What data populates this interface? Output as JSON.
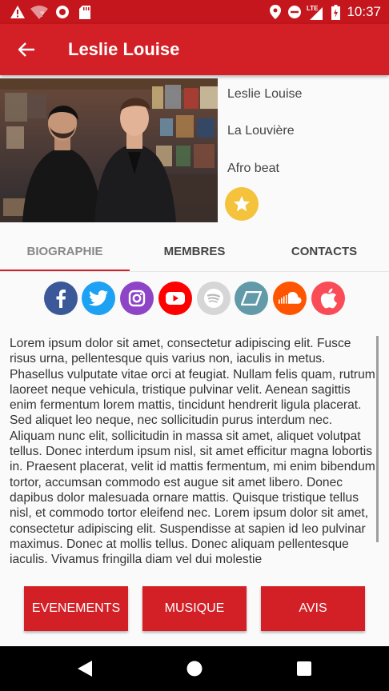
{
  "status_bar": {
    "time": "10:37",
    "network": "LTE"
  },
  "app_bar": {
    "title": "Leslie Louise"
  },
  "artist": {
    "name": "Leslie Louise",
    "city": "La Louvière",
    "genre": "Afro beat"
  },
  "tabs": [
    {
      "label": "BIOGRAPHIE",
      "active": true
    },
    {
      "label": "MEMBRES",
      "active": false
    },
    {
      "label": "CONTACTS",
      "active": false
    }
  ],
  "social_links": [
    {
      "name": "facebook",
      "color": "#3b5998",
      "glyph": "f"
    },
    {
      "name": "twitter",
      "color": "#1da1f2",
      "glyph": ""
    },
    {
      "name": "instagram",
      "color": "#8e44c7",
      "glyph": ""
    },
    {
      "name": "youtube",
      "color": "#ff0000",
      "glyph": ""
    },
    {
      "name": "spotify",
      "color": "#d6d6d6",
      "glyph": ""
    },
    {
      "name": "bandcamp",
      "color": "#629aa9",
      "glyph": ""
    },
    {
      "name": "soundcloud",
      "color": "#ff5500",
      "glyph": ""
    },
    {
      "name": "apple",
      "color": "#f94c57",
      "glyph": ""
    }
  ],
  "biography": "Lorem ipsum dolor sit amet, consectetur adipiscing elit. Fusce risus urna, pellentesque quis varius non, iaculis in metus. Phasellus vulputate vitae orci at feugiat. Nullam felis quam, rutrum laoreet neque vehicula, tristique pulvinar velit. Aenean sagittis enim fermentum lorem mattis, tincidunt hendrerit ligula placerat. Sed aliquet leo neque, nec sollicitudin purus interdum nec. Aliquam nunc elit, sollicitudin in massa sit amet, aliquet volutpat tellus. Donec interdum ipsum nisl, sit amet efficitur magna lobortis in. Praesent placerat, velit id mattis fermentum, mi enim bibendum tortor, accumsan commodo est augue sit amet libero. Donec dapibus dolor malesuada ornare mattis. Quisque tristique tellus nisl, et commodo tortor eleifend nec. Lorem ipsum dolor sit amet, consectetur adipiscing elit. Suspendisse at sapien id leo pulvinar maximus. Donec at mollis tellus. Donec aliquam pellentesque iaculis. Vivamus fringilla diam vel dui molestie",
  "buttons": {
    "events": "EVENEMENTS",
    "music": "MUSIQUE",
    "reviews": "AVIS"
  },
  "colors": {
    "primary": "#d32026",
    "status_bar": "#c4161c",
    "star": "#f4c23b"
  }
}
